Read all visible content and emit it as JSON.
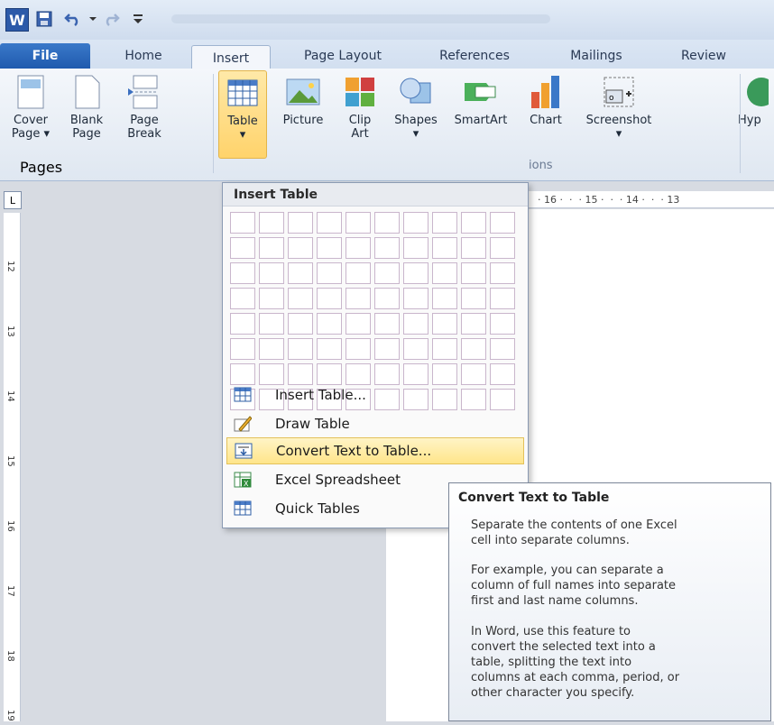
{
  "quick_access": {
    "app_icon": "W"
  },
  "tabs": [
    "File",
    "Home",
    "Insert",
    "Page Layout",
    "References",
    "Mailings",
    "Review"
  ],
  "ribbon": {
    "buttons": [
      {
        "label": "Cover\nPage ▾",
        "icon": "cover-page-icon"
      },
      {
        "label": "Blank\nPage",
        "icon": "blank-page-icon"
      },
      {
        "label": "Page\nBreak",
        "icon": "page-break-icon"
      },
      {
        "label": "Table\n▾",
        "icon": "table-icon"
      },
      {
        "label": "Picture",
        "icon": "picture-icon"
      },
      {
        "label": "Clip\nArt",
        "icon": "clip-art-icon"
      },
      {
        "label": "Shapes\n▾",
        "icon": "shapes-icon"
      },
      {
        "label": "SmartArt",
        "icon": "smartart-icon"
      },
      {
        "label": "Chart",
        "icon": "chart-icon"
      },
      {
        "label": "Screenshot\n▾",
        "icon": "screenshot-icon"
      },
      {
        "label": "Hyp",
        "icon": "hyperlink-icon"
      }
    ],
    "group_pages": "Pages",
    "group_illustrations_partial": "ions"
  },
  "ruler": {
    "corner": "L",
    "h_ticks": "· 16 ·  ·  · 15 ·  ·  · 14 ·  ·  · 13"
  },
  "table_menu": {
    "title": "Insert Table",
    "grid_cols": 10,
    "grid_rows": 8,
    "items": [
      {
        "label": "Insert Table...",
        "icon": "insert-table-icon"
      },
      {
        "label": "Draw Table",
        "icon": "draw-table-icon"
      },
      {
        "label": "Convert Text to Table...",
        "icon": "convert-text-icon",
        "highlighted": true
      },
      {
        "label": "Excel Spreadsheet",
        "icon": "excel-spreadsheet-icon"
      },
      {
        "label": "Quick Tables",
        "icon": "quick-tables-icon"
      }
    ]
  },
  "tooltip": {
    "title": "Convert Text to Table",
    "paragraphs": [
      "Separate the contents of one Excel\ncell into separate columns.",
      "For example, you can separate a\ncolumn of full names into separate\nfirst and last name columns.",
      "In Word, use this feature to\nconvert the selected text into a\ntable, splitting the text into\ncolumns at each comma, period, or\nother character you specify."
    ]
  }
}
